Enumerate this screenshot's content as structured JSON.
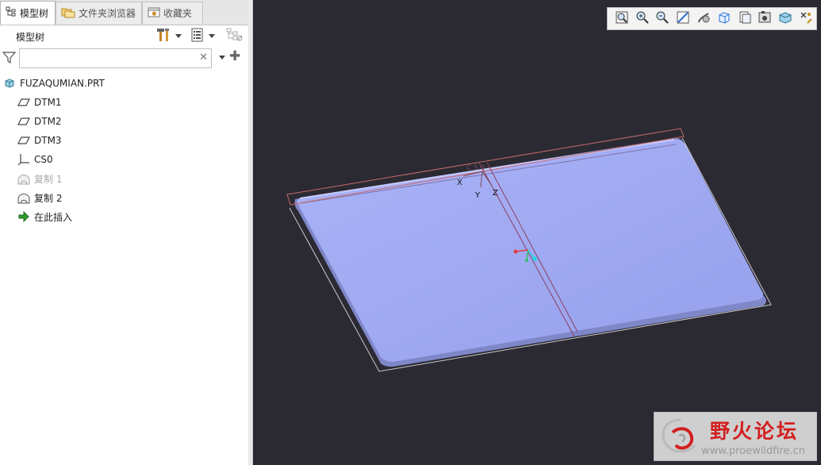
{
  "tabs": [
    {
      "label": "模型树",
      "icon": "model-tree-icon",
      "active": true
    },
    {
      "label": "文件夹浏览器",
      "icon": "folder-browser-icon",
      "active": false
    },
    {
      "label": "收藏夹",
      "icon": "favorites-icon",
      "active": false
    }
  ],
  "tree": {
    "title": "模型树",
    "search_value": "",
    "items": [
      {
        "label": "FUZAQUMIAN.PRT",
        "icon": "part-icon",
        "dimmed": false
      },
      {
        "label": "DTM1",
        "icon": "datum-plane-icon",
        "dimmed": false
      },
      {
        "label": "DTM2",
        "icon": "datum-plane-icon",
        "dimmed": false
      },
      {
        "label": "DTM3",
        "icon": "datum-plane-icon",
        "dimmed": false
      },
      {
        "label": "CS0",
        "icon": "coordinate-system-icon",
        "dimmed": false
      },
      {
        "label": "复制 1",
        "icon": "copy-feature-icon",
        "dimmed": true
      },
      {
        "label": "复制 2",
        "icon": "copy-feature-icon",
        "dimmed": false
      },
      {
        "label": "在此插入",
        "icon": "insert-here-arrow-icon",
        "dimmed": false
      }
    ]
  },
  "view_toolbar": {
    "buttons": [
      "refit-icon",
      "zoom-in-icon",
      "zoom-out-icon",
      "repaint-icon",
      "display-style-icon",
      "saved-orientations-icon",
      "view-manager-icon",
      "perspective-icon",
      "spin-center-icon",
      "annotation-display-icon"
    ]
  },
  "viewport": {
    "axis_labels": {
      "x": "X",
      "y": "Y",
      "z": "Z"
    },
    "surface_color": "#9ea8f0",
    "background_color": "#2b2a33"
  },
  "watermark": {
    "title": "野火论坛",
    "url": "www.proewildfire.cn"
  }
}
